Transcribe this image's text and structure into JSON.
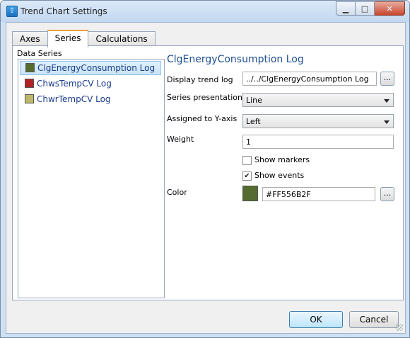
{
  "window": {
    "title": "Trend Chart Settings",
    "app_icon": "upload-arrow-icon",
    "controls": {
      "minimize": "minimize-icon",
      "maximize": "maximize-icon",
      "close": "close-icon"
    }
  },
  "tabs": [
    {
      "label": "Axes",
      "active": false
    },
    {
      "label": "Series",
      "active": true
    },
    {
      "label": "Calculations",
      "active": false
    }
  ],
  "data_series": {
    "label": "Data Series",
    "items": [
      {
        "name": "ClgEnergyConsumption Log",
        "color": "#556B2F",
        "selected": true
      },
      {
        "name": "ChwsTempCV Log",
        "color": "#B22222",
        "selected": false
      },
      {
        "name": "ChwrTempCV Log",
        "color": "#BDB76B",
        "selected": false
      }
    ]
  },
  "details": {
    "title": "ClgEnergyConsumption Log",
    "display_trend_log": {
      "label": "Display trend log",
      "value": "../../ClgEnergyConsumption Log",
      "browse": "..."
    },
    "series_presentation": {
      "label": "Series presentation",
      "value": "Line"
    },
    "assigned_y_axis": {
      "label": "Assigned to Y-axis",
      "value": "Left"
    },
    "weight": {
      "label": "Weight",
      "value": "1"
    },
    "show_markers": {
      "label": "Show markers",
      "checked": false,
      "mark": ""
    },
    "show_events": {
      "label": "Show events",
      "checked": true,
      "mark": "✔"
    },
    "color": {
      "label": "Color",
      "value": "#FF556B2F",
      "swatch": "#556B2F",
      "browse": "..."
    }
  },
  "buttons": {
    "ok": "OK",
    "cancel": "Cancel"
  }
}
